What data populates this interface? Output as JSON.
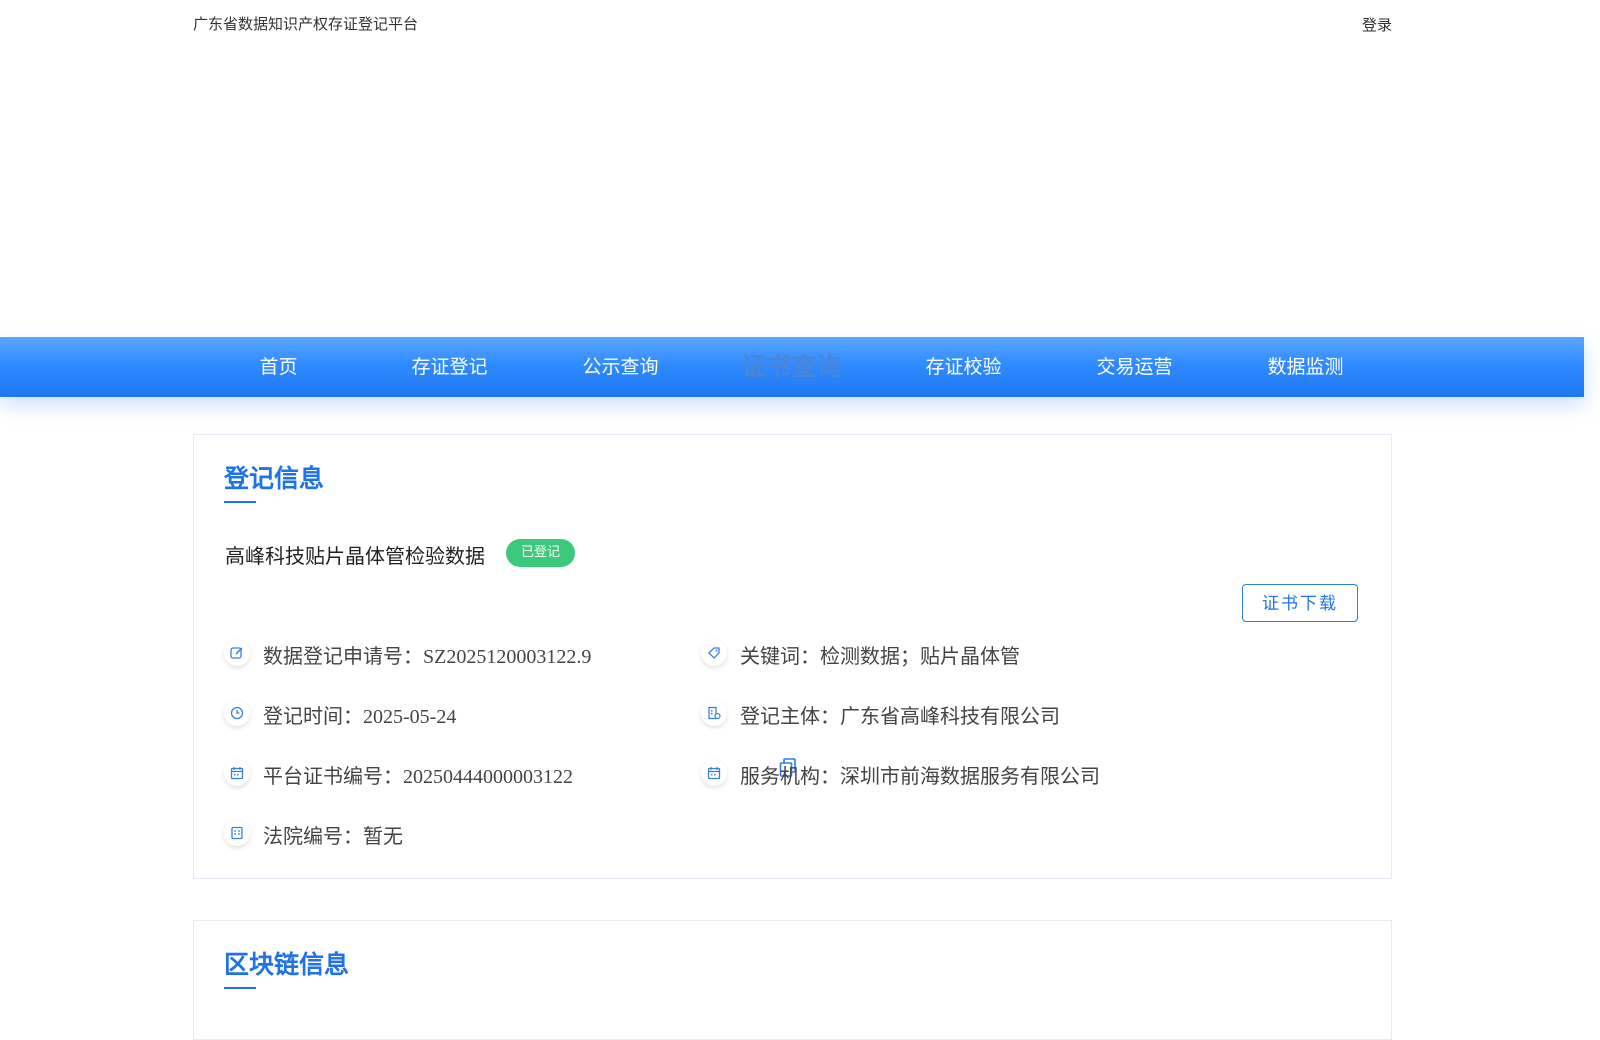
{
  "header": {
    "site_title": "广东省数据知识产权存证登记平台",
    "login": "登录"
  },
  "nav": {
    "items": [
      "首页",
      "存证登记",
      "公示查询",
      "证书查询",
      "存证校验",
      "交易运营",
      "数据监测"
    ],
    "active_index": 3
  },
  "registration": {
    "title": "登记信息",
    "data_name": "高峰科技贴片晶体管检验数据",
    "status": "已登记",
    "download_button": "证书下载",
    "fields": {
      "application_no": {
        "label": "数据登记申请号：",
        "value": "SZ2025120003122.9"
      },
      "keywords": {
        "label": "关键词：",
        "value": "检测数据；贴片晶体管"
      },
      "reg_time": {
        "label": "登记时间：",
        "value": "2025-05-24"
      },
      "subject": {
        "label": "登记主体：",
        "value": "广东省高峰科技有限公司"
      },
      "cert_no": {
        "label": "平台证书编号：",
        "value": "20250444000003122"
      },
      "agency": {
        "label": "服务机构：",
        "value": "深圳市前海数据服务有限公司"
      },
      "court_no": {
        "label": "法院编号：",
        "value": "暂无"
      }
    }
  },
  "blockchain": {
    "title": "区块链信息"
  },
  "colors": {
    "primary": "#1f73e6",
    "nav_top": "#5aa7ff",
    "nav_bottom": "#1f78f2",
    "badge": "#3cc97c"
  },
  "icons": [
    "edit-icon",
    "tag-icon",
    "clock-icon",
    "building-icon",
    "calendar-icon",
    "copy-icon",
    "document-icon"
  ]
}
